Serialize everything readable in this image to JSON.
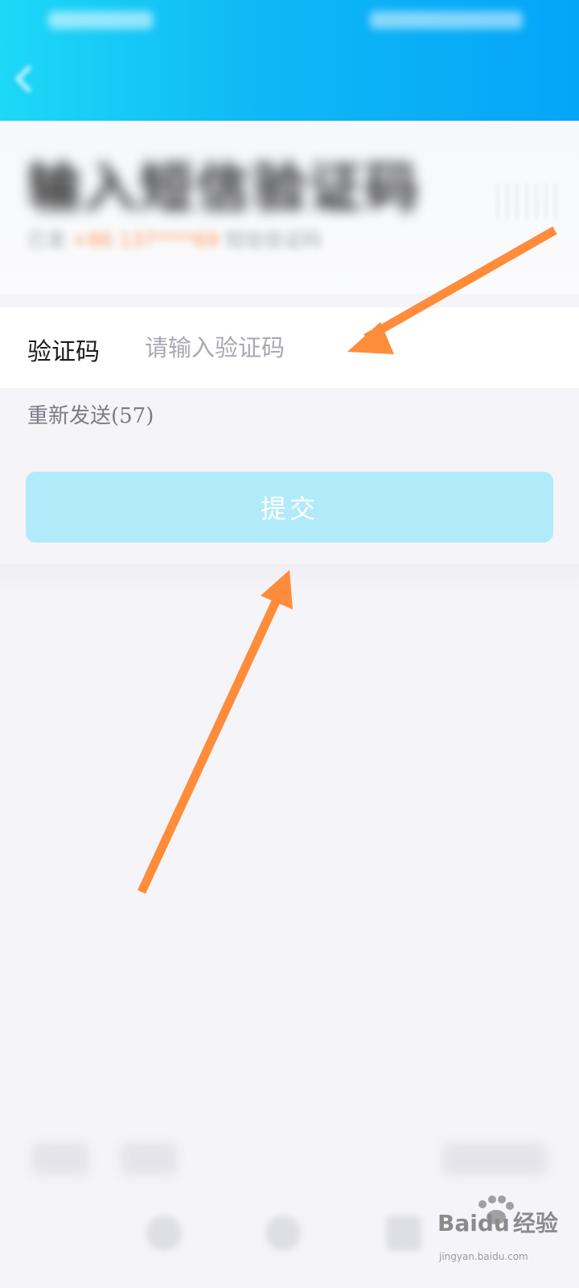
{
  "header": {
    "back_icon": "back-arrow-icon",
    "colors": {
      "gradient_start": "#1dd8f7",
      "gradient_end": "#05a5f8"
    }
  },
  "title_card": {
    "title": "输入短信验证码",
    "subtitle_prefix": "已发",
    "phone": "+86 137****69",
    "subtitle_suffix": "短信验证码"
  },
  "verification": {
    "label": "验证码",
    "input_value": "",
    "placeholder": "请输入验证码"
  },
  "resend": {
    "label": "重新发送(57)"
  },
  "submit": {
    "label": "提交",
    "color": "#b1ebfa"
  },
  "annotations": {
    "arrow_color": "#ff8c3a",
    "arrows": [
      "arrow-to-input",
      "arrow-to-submit"
    ]
  },
  "watermark": {
    "brand": "Bai",
    "brand_suffix": "经验",
    "url": "jingyan.baidu.com"
  }
}
